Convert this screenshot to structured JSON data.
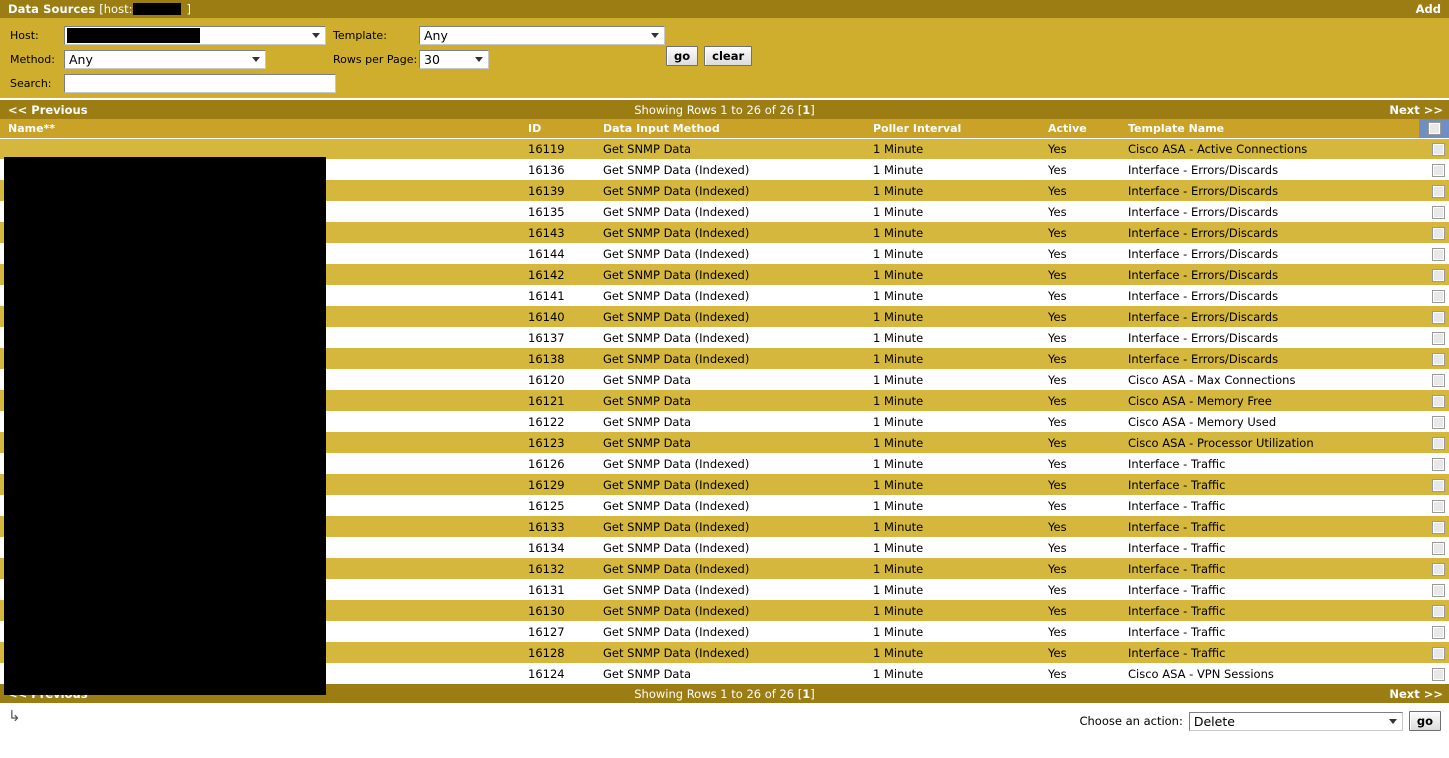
{
  "titlebar": {
    "title": "Data Sources",
    "host_prefix": "[host:",
    "host_suffix": "]",
    "add_label": "Add"
  },
  "filters": {
    "host_label": "Host:",
    "host_value": "",
    "method_label": "Method:",
    "method_value": "Any",
    "search_label": "Search:",
    "search_value": "",
    "search_placeholder": "",
    "template_label": "Template:",
    "template_value": "Any",
    "rows_label": "Rows per Page:",
    "rows_value": "30",
    "go_label": "go",
    "clear_label": "clear"
  },
  "pager": {
    "previous_label": "<< Previous",
    "next_label": "Next >>",
    "showing_prefix": "Showing Rows 1 to 26 of 26 [",
    "page_number": "1",
    "showing_suffix": "]"
  },
  "columns": {
    "name": "Name**",
    "id": "ID",
    "data_input_method": "Data Input Method",
    "poller_interval": "Poller Interval",
    "active": "Active",
    "template_name": "Template Name"
  },
  "footer": {
    "action_label": "Choose an action:",
    "action_value": "Delete",
    "go_label": "go",
    "cursor_icon": "↳"
  },
  "colors": {
    "title_bar": "#9b7d14",
    "filter_bg": "#cfae2e",
    "header_row": "#c9a227",
    "alt_row": "#d4b73c",
    "norm_row": "#ffffff",
    "checkbox_header_bg": "#6f8fc0",
    "redaction": "#000000"
  },
  "rows": [
    {
      "name": "",
      "id": "16119",
      "method": "Get SNMP Data",
      "poller": "1 Minute",
      "active": "Yes",
      "template": "Cisco ASA - Active Connections"
    },
    {
      "name": "",
      "id": "16136",
      "method": "Get SNMP Data (Indexed)",
      "poller": "1 Minute",
      "active": "Yes",
      "template": "Interface - Errors/Discards"
    },
    {
      "name": "",
      "id": "16139",
      "method": "Get SNMP Data (Indexed)",
      "poller": "1 Minute",
      "active": "Yes",
      "template": "Interface - Errors/Discards"
    },
    {
      "name": "",
      "id": "16135",
      "method": "Get SNMP Data (Indexed)",
      "poller": "1 Minute",
      "active": "Yes",
      "template": "Interface - Errors/Discards"
    },
    {
      "name": "",
      "id": "16143",
      "method": "Get SNMP Data (Indexed)",
      "poller": "1 Minute",
      "active": "Yes",
      "template": "Interface - Errors/Discards"
    },
    {
      "name": "",
      "id": "16144",
      "method": "Get SNMP Data (Indexed)",
      "poller": "1 Minute",
      "active": "Yes",
      "template": "Interface - Errors/Discards"
    },
    {
      "name": "",
      "id": "16142",
      "method": "Get SNMP Data (Indexed)",
      "poller": "1 Minute",
      "active": "Yes",
      "template": "Interface - Errors/Discards"
    },
    {
      "name": "",
      "id": "16141",
      "method": "Get SNMP Data (Indexed)",
      "poller": "1 Minute",
      "active": "Yes",
      "template": "Interface - Errors/Discards"
    },
    {
      "name": "",
      "id": "16140",
      "method": "Get SNMP Data (Indexed)",
      "poller": "1 Minute",
      "active": "Yes",
      "template": "Interface - Errors/Discards"
    },
    {
      "name": "",
      "id": "16137",
      "method": "Get SNMP Data (Indexed)",
      "poller": "1 Minute",
      "active": "Yes",
      "template": "Interface - Errors/Discards"
    },
    {
      "name": "",
      "id": "16138",
      "method": "Get SNMP Data (Indexed)",
      "poller": "1 Minute",
      "active": "Yes",
      "template": "Interface - Errors/Discards"
    },
    {
      "name": "",
      "id": "16120",
      "method": "Get SNMP Data",
      "poller": "1 Minute",
      "active": "Yes",
      "template": "Cisco ASA - Max Connections"
    },
    {
      "name": "",
      "id": "16121",
      "method": "Get SNMP Data",
      "poller": "1 Minute",
      "active": "Yes",
      "template": "Cisco ASA - Memory Free"
    },
    {
      "name": "",
      "id": "16122",
      "method": "Get SNMP Data",
      "poller": "1 Minute",
      "active": "Yes",
      "template": "Cisco ASA - Memory Used"
    },
    {
      "name": "",
      "id": "16123",
      "method": "Get SNMP Data",
      "poller": "1 Minute",
      "active": "Yes",
      "template": "Cisco ASA - Processor Utilization"
    },
    {
      "name": "",
      "id": "16126",
      "method": "Get SNMP Data (Indexed)",
      "poller": "1 Minute",
      "active": "Yes",
      "template": "Interface - Traffic"
    },
    {
      "name": "",
      "id": "16129",
      "method": "Get SNMP Data (Indexed)",
      "poller": "1 Minute",
      "active": "Yes",
      "template": "Interface - Traffic"
    },
    {
      "name": "",
      "id": "16125",
      "method": "Get SNMP Data (Indexed)",
      "poller": "1 Minute",
      "active": "Yes",
      "template": "Interface - Traffic"
    },
    {
      "name": "",
      "id": "16133",
      "method": "Get SNMP Data (Indexed)",
      "poller": "1 Minute",
      "active": "Yes",
      "template": "Interface - Traffic"
    },
    {
      "name": "",
      "id": "16134",
      "method": "Get SNMP Data (Indexed)",
      "poller": "1 Minute",
      "active": "Yes",
      "template": "Interface - Traffic"
    },
    {
      "name": "",
      "id": "16132",
      "method": "Get SNMP Data (Indexed)",
      "poller": "1 Minute",
      "active": "Yes",
      "template": "Interface - Traffic"
    },
    {
      "name": "",
      "id": "16131",
      "method": "Get SNMP Data (Indexed)",
      "poller": "1 Minute",
      "active": "Yes",
      "template": "Interface - Traffic"
    },
    {
      "name": "",
      "id": "16130",
      "method": "Get SNMP Data (Indexed)",
      "poller": "1 Minute",
      "active": "Yes",
      "template": "Interface - Traffic"
    },
    {
      "name": "",
      "id": "16127",
      "method": "Get SNMP Data (Indexed)",
      "poller": "1 Minute",
      "active": "Yes",
      "template": "Interface - Traffic"
    },
    {
      "name": "",
      "id": "16128",
      "method": "Get SNMP Data (Indexed)",
      "poller": "1 Minute",
      "active": "Yes",
      "template": "Interface - Traffic"
    },
    {
      "name": "",
      "id": "16124",
      "method": "Get SNMP Data",
      "poller": "1 Minute",
      "active": "Yes",
      "template": "Cisco ASA - VPN Sessions"
    }
  ]
}
